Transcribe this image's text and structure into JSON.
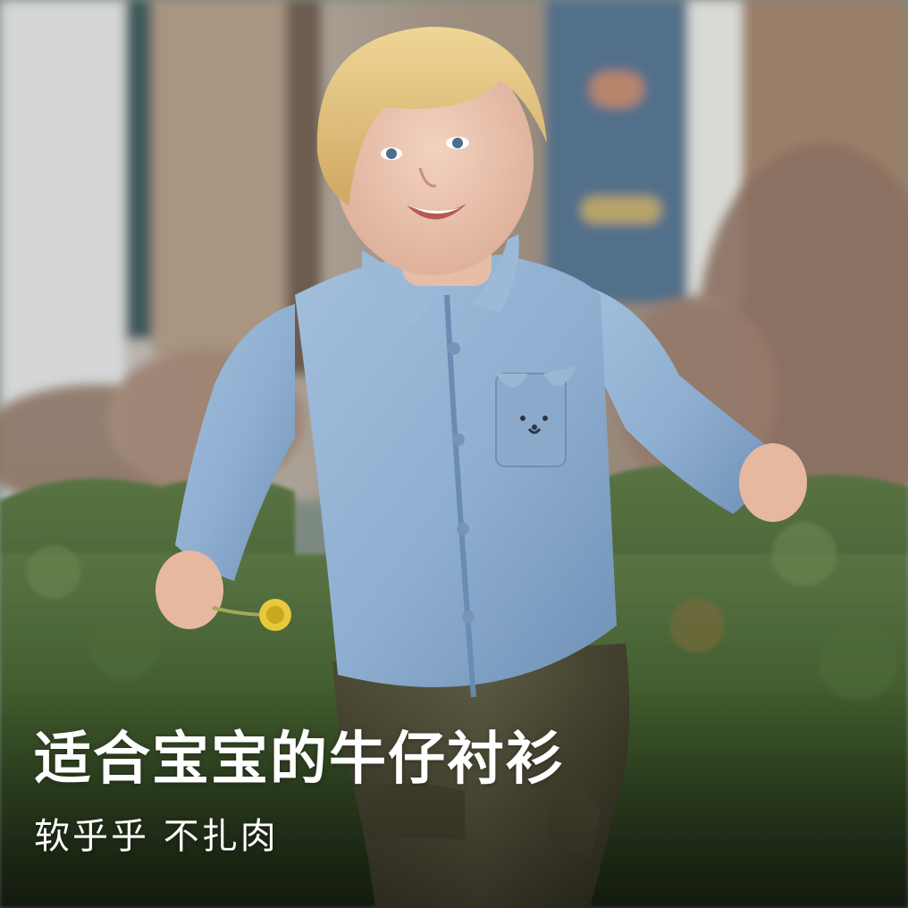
{
  "caption": {
    "headline": "适合宝宝的牛仔衬衫",
    "subline": "软乎乎 不扎肉"
  },
  "colors": {
    "caption_text": "#ffffff",
    "shirt_denim": "#8eaed0",
    "hedge_green": "#3f5a2c",
    "pants_olive": "#56533d",
    "hair_blond": "#e2c27c"
  }
}
